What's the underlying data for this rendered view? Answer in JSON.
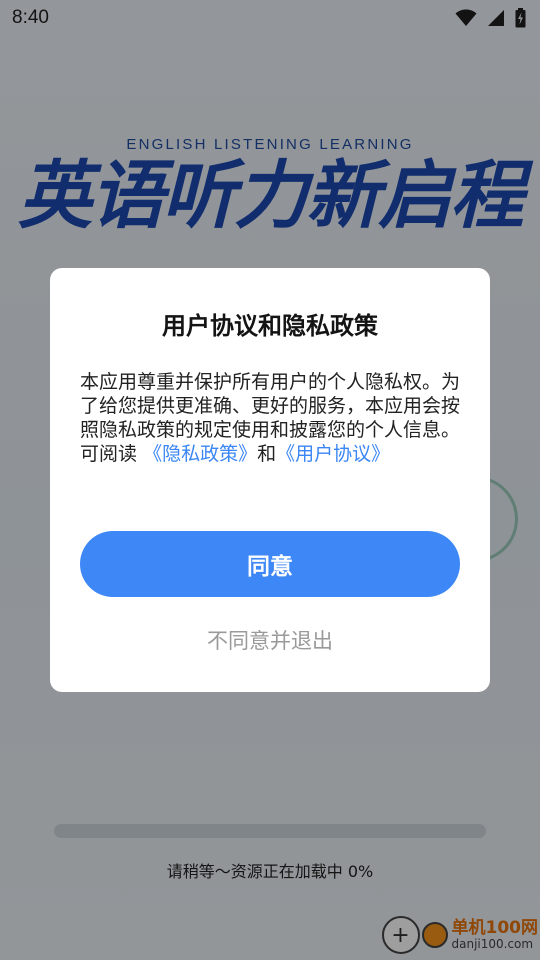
{
  "status_bar": {
    "time": "8:40",
    "icons": [
      "wifi-icon",
      "cellular-signal-icon",
      "battery-charging-icon"
    ]
  },
  "splash": {
    "tagline": "ENGLISH LISTENING LEARNING",
    "title": "英语听力新启程",
    "loading_text": "请稍等～资源正在加载中 0%",
    "progress": 0
  },
  "dialog": {
    "title": "用户协议和隐私政策",
    "body": "本应用尊重并保护所有用户的个人隐私权。为了给您提供更准确、更好的服务，本应用会按照隐私政策的规定使用和披露您的个人信息。",
    "read_prefix": "可阅读",
    "privacy_link": "《隐私政策》",
    "and_text": "和",
    "user_agreement_link": "《用户协议》",
    "agree_label": "同意",
    "disagree_label": "不同意并退出"
  },
  "watermark": {
    "name": "单机100网",
    "url": "danji100.com"
  },
  "colors": {
    "accent": "#3e87f6",
    "link": "#3a86f4",
    "splash_title": "#1c49b0"
  }
}
